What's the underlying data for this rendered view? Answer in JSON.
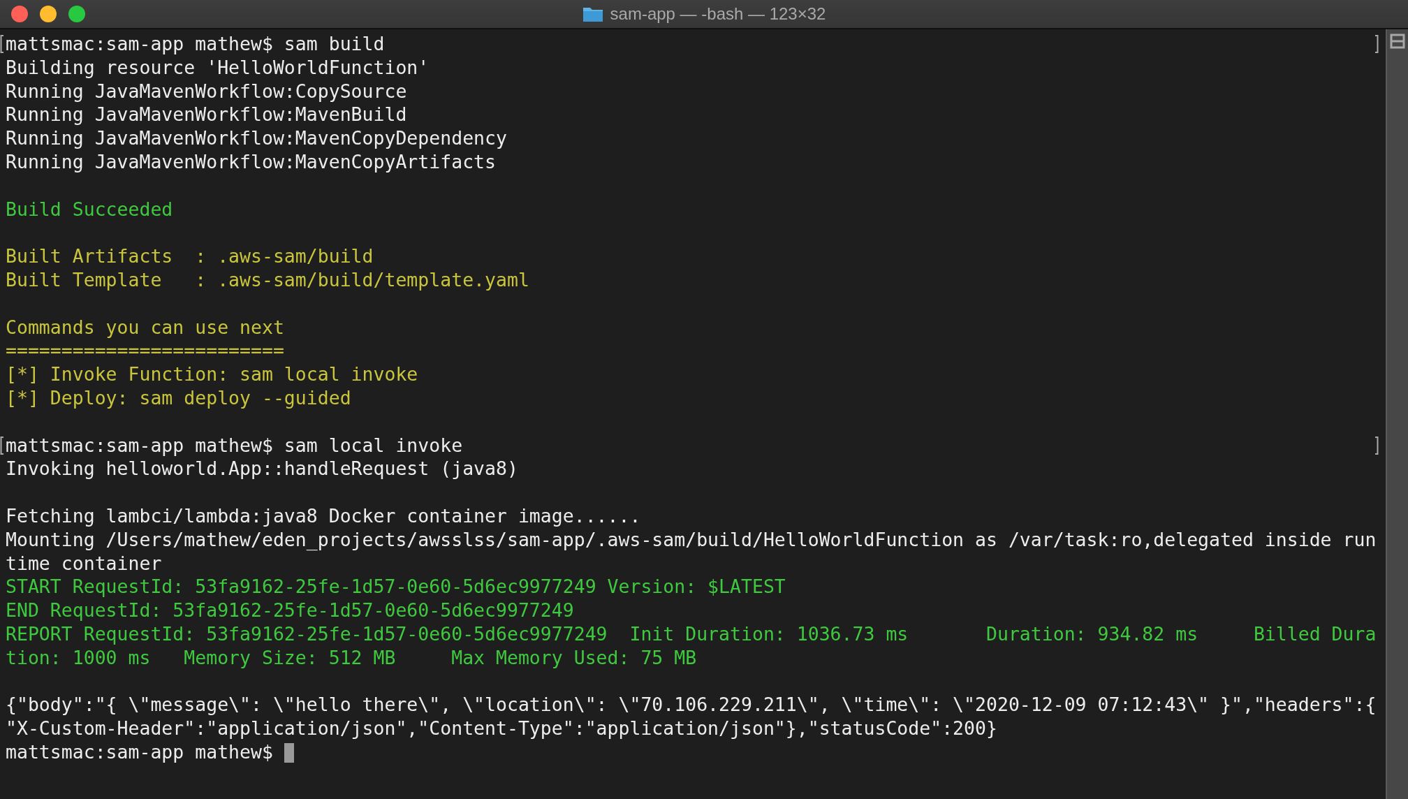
{
  "window": {
    "title": "sam-app — -bash — 123×32"
  },
  "lines": [
    {
      "kind": "plain",
      "marked": true,
      "cursor": false,
      "text": "mattsmac:sam-app mathew$ sam build"
    },
    {
      "kind": "plain",
      "marked": false,
      "cursor": false,
      "text": "Building resource 'HelloWorldFunction'"
    },
    {
      "kind": "plain",
      "marked": false,
      "cursor": false,
      "text": "Running JavaMavenWorkflow:CopySource"
    },
    {
      "kind": "plain",
      "marked": false,
      "cursor": false,
      "text": "Running JavaMavenWorkflow:MavenBuild"
    },
    {
      "kind": "plain",
      "marked": false,
      "cursor": false,
      "text": "Running JavaMavenWorkflow:MavenCopyDependency"
    },
    {
      "kind": "plain",
      "marked": false,
      "cursor": false,
      "text": "Running JavaMavenWorkflow:MavenCopyArtifacts"
    },
    {
      "kind": "blank"
    },
    {
      "kind": "success",
      "marked": false,
      "cursor": false,
      "text": "Build Succeeded"
    },
    {
      "kind": "blank"
    },
    {
      "kind": "info",
      "marked": false,
      "cursor": false,
      "text": "Built Artifacts  : .aws-sam/build"
    },
    {
      "kind": "info",
      "marked": false,
      "cursor": false,
      "text": "Built Template   : .aws-sam/build/template.yaml"
    },
    {
      "kind": "blank"
    },
    {
      "kind": "info",
      "marked": false,
      "cursor": false,
      "text": "Commands you can use next"
    },
    {
      "kind": "info",
      "marked": false,
      "cursor": false,
      "text": "========================="
    },
    {
      "kind": "info",
      "marked": false,
      "cursor": false,
      "text": "[*] Invoke Function: sam local invoke"
    },
    {
      "kind": "info",
      "marked": false,
      "cursor": false,
      "text": "[*] Deploy: sam deploy --guided"
    },
    {
      "kind": "blank"
    },
    {
      "kind": "plain",
      "marked": true,
      "cursor": false,
      "text": "mattsmac:sam-app mathew$ sam local invoke"
    },
    {
      "kind": "plain",
      "marked": false,
      "cursor": false,
      "text": "Invoking helloworld.App::handleRequest (java8)"
    },
    {
      "kind": "blank"
    },
    {
      "kind": "plain",
      "marked": false,
      "cursor": false,
      "text": "Fetching lambci/lambda:java8 Docker container image......"
    },
    {
      "kind": "plain",
      "marked": false,
      "cursor": false,
      "text": "Mounting /Users/mathew/eden_projects/awsslss/sam-app/.aws-sam/build/HelloWorldFunction as /var/task:ro,delegated inside run"
    },
    {
      "kind": "plain",
      "marked": false,
      "cursor": false,
      "text": "time container"
    },
    {
      "kind": "success",
      "marked": false,
      "cursor": false,
      "text": "START RequestId: 53fa9162-25fe-1d57-0e60-5d6ec9977249 Version: $LATEST"
    },
    {
      "kind": "success",
      "marked": false,
      "cursor": false,
      "text": "END RequestId: 53fa9162-25fe-1d57-0e60-5d6ec9977249"
    },
    {
      "kind": "success",
      "marked": false,
      "cursor": false,
      "text": "REPORT RequestId: 53fa9162-25fe-1d57-0e60-5d6ec9977249  Init Duration: 1036.73 ms       Duration: 934.82 ms     Billed Dura"
    },
    {
      "kind": "success",
      "marked": false,
      "cursor": false,
      "text": "tion: 1000 ms   Memory Size: 512 MB     Max Memory Used: 75 MB"
    },
    {
      "kind": "blank"
    },
    {
      "kind": "plain",
      "marked": false,
      "cursor": false,
      "text": "{\"body\":\"{ \\\"message\\\": \\\"hello there\\\", \\\"location\\\": \\\"70.106.229.211\\\", \\\"time\\\": \\\"2020-12-09 07:12:43\\\" }\",\"headers\":{"
    },
    {
      "kind": "plain",
      "marked": false,
      "cursor": false,
      "text": "\"X-Custom-Header\":\"application/json\",\"Content-Type\":\"application/json\"},\"statusCode\":200}"
    },
    {
      "kind": "plain",
      "marked": false,
      "cursor": true,
      "text": "mattsmac:sam-app mathew$ "
    }
  ]
}
